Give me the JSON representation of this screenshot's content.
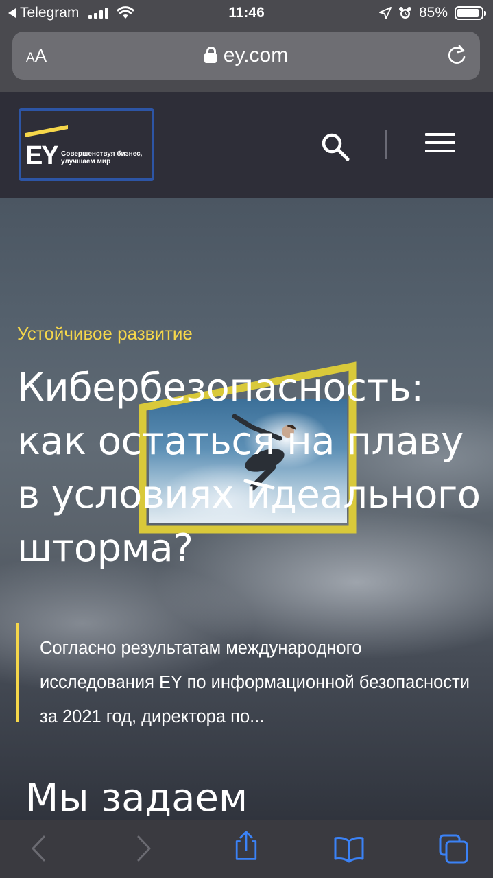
{
  "status_bar": {
    "back_app": "Telegram",
    "time": "11:46",
    "battery": "85%",
    "battery_level": 0.85
  },
  "browser": {
    "text_size_label_small": "A",
    "text_size_label_large": "A",
    "url": "ey.com"
  },
  "header": {
    "logo_text": "EY",
    "logo_tagline_line1": "Совершенствуя бизнес,",
    "logo_tagline_line2": "улучшаем мир",
    "colors": {
      "logo_accent": "#f6d74a",
      "logo_border": "#2d55a5"
    }
  },
  "hero": {
    "category": "Устойчивое развитие",
    "title": "Кибербезопасность: как остаться на плаву в условиях идеального шторма?",
    "summary": "Согласно результатам международного исследования EY по информационной безопасности за 2021 год, директора по...",
    "next_heading": "Мы задаем",
    "accent_color": "#f6d74a"
  },
  "toolbar": {
    "icons": [
      "back-icon",
      "forward-icon",
      "share-icon",
      "bookmarks-icon",
      "tabs-icon"
    ]
  }
}
